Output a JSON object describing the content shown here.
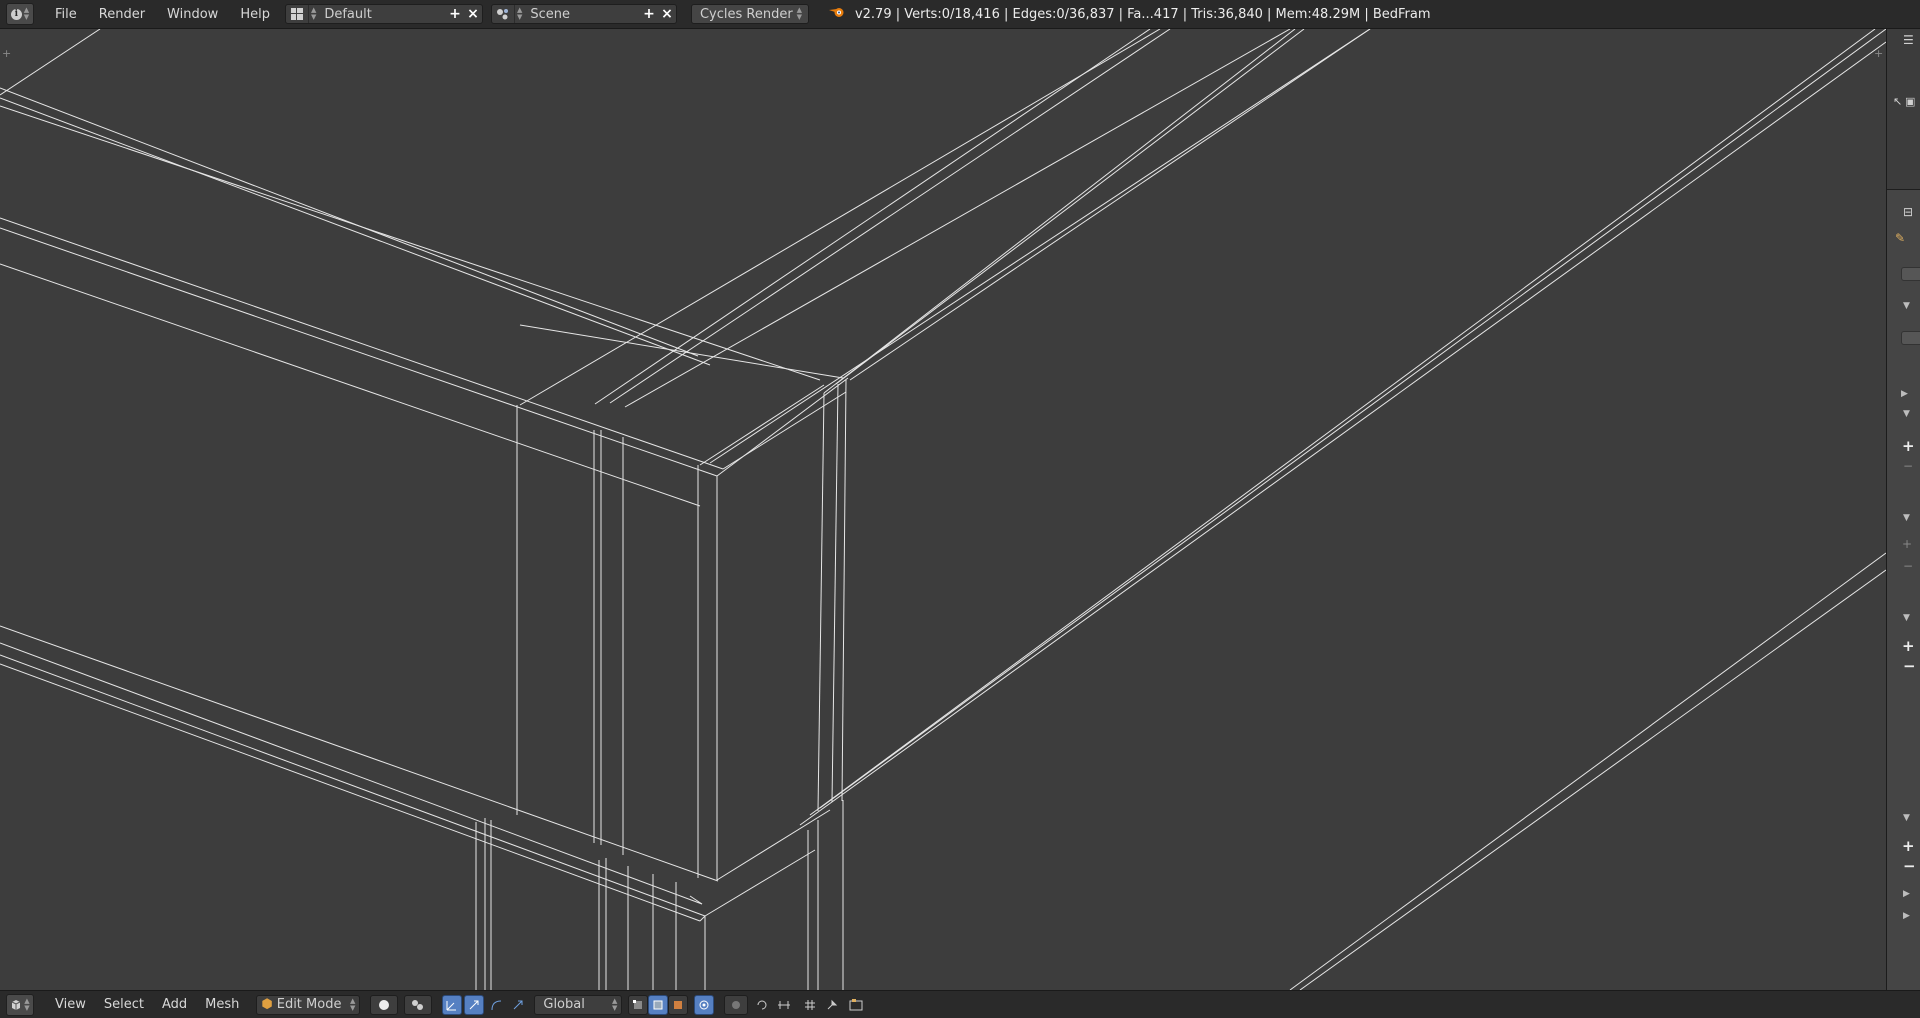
{
  "header": {
    "menus": [
      "File",
      "Render",
      "Window",
      "Help"
    ],
    "layout_name": "Default",
    "scene_name": "Scene",
    "render_engine": "Cycles Render",
    "stats": "v2.79 | Verts:0/18,416 | Edges:0/36,837 | Fa...417 | Tris:36,840 | Mem:48.29M | BedFram",
    "add_symbol": "+",
    "remove_symbol": "×"
  },
  "footer": {
    "menus": [
      "View",
      "Select",
      "Add",
      "Mesh"
    ],
    "mode": "Edit Mode",
    "orientation": "Global"
  },
  "icons": {
    "editor_type": "info-icon",
    "layout": "screen-layout-icon",
    "scene": "scene-icon",
    "engine_logo": "blender-logo-icon",
    "viewport_editor": "3d-viewport-icon",
    "mode": "edit-mode-icon",
    "shading": "solid-shading-icon",
    "pivot": "pivot-point-icon",
    "manipulators": [
      "translate-manipulator-icon",
      "rotate-manipulator-icon",
      "scale-manipulator-icon"
    ],
    "select_modes": [
      "vertex-select-icon",
      "edge-select-icon",
      "face-select-icon"
    ],
    "occlude": "limit-selection-icon",
    "proportional": "proportional-edit-icon",
    "snap": "snap-icon",
    "render_preview": "opengl-render-icon"
  },
  "colors": {
    "header_bg": "#2a2a2a",
    "viewport_bg": "#3d3d3d",
    "wire": "#e6e6e6",
    "accent_blue": "#5680c2",
    "blender_orange": "#e87d0d"
  }
}
